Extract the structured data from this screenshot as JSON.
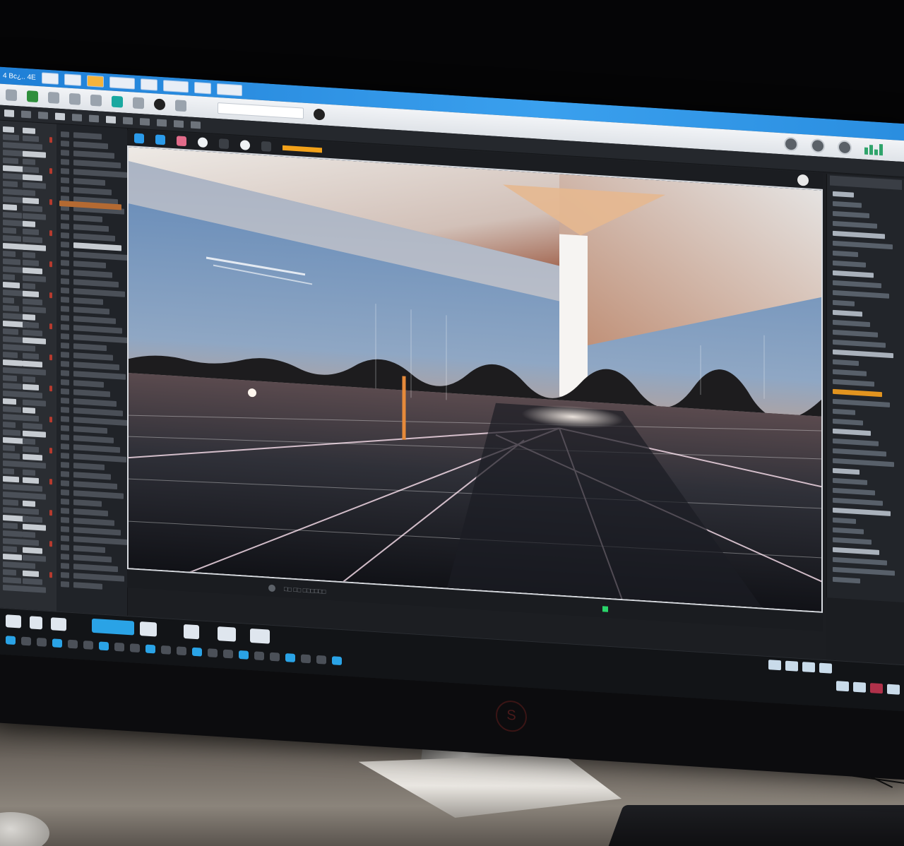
{
  "window": {
    "title": "4 Bc¿.. 4E",
    "selection_label": "□□□"
  },
  "ribbon": {
    "icons": [
      "app-icon",
      "file-icon",
      "link-icon",
      "pin-icon",
      "record-icon",
      "globe-icon",
      "gear-icon",
      "obj-icon",
      "user-icon"
    ],
    "right_icons": [
      "globe-icon",
      "gear-icon",
      "user-icon"
    ]
  },
  "viewport": {
    "toolbar_status": "",
    "status_label": "□□ □□ □□□□□□"
  },
  "colors": {
    "titlebar": "#2a8ee0",
    "accent_orange": "#f3a21a",
    "accent_blue": "#2b9bea",
    "status_green": "#2ad46a",
    "sky_top": "#3b6fa8",
    "horizon_glow": "#e88a4a"
  }
}
